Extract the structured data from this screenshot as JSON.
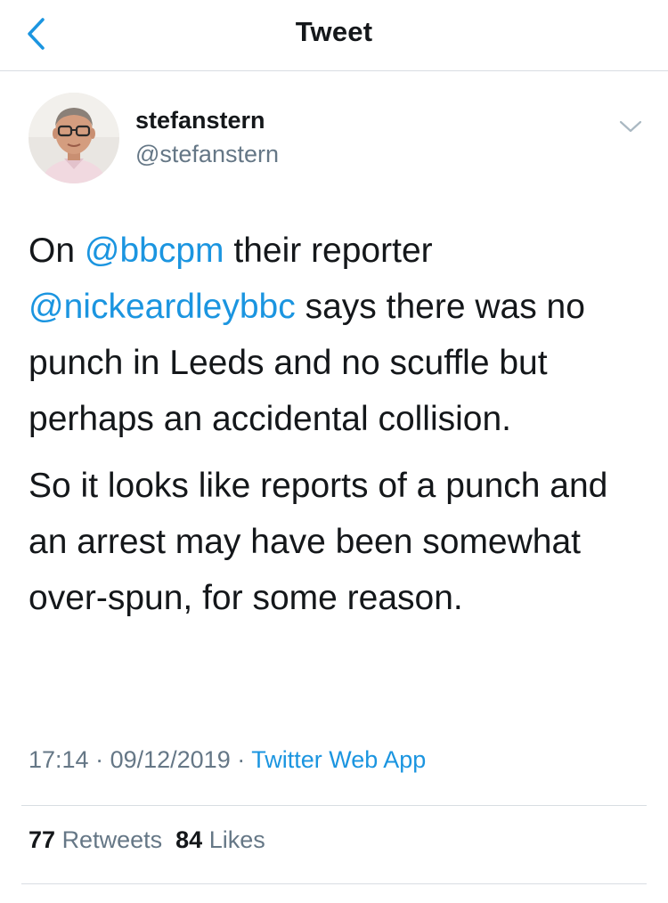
{
  "header": {
    "title": "Tweet",
    "back_icon": "chevron-left-icon"
  },
  "author": {
    "display_name": "stefanstern",
    "handle": "@stefanstern"
  },
  "tweet": {
    "p1": {
      "t1": "On ",
      "m1": "@bbcpm",
      "t2": " their reporter ",
      "m2": "@nickeardleybbc",
      "t3": " says there was no punch in Leeds and no scuffle but perhaps an accidental collision."
    },
    "p2": "So it looks like reports of a punch and an arrest may have been somewhat over-spun, for some reason."
  },
  "meta": {
    "time": "17:14",
    "date": "09/12/2019",
    "separator": " · ",
    "source": "Twitter Web App"
  },
  "stats": {
    "retweets_count": "77",
    "retweets_label": "Retweets",
    "likes_count": "84",
    "likes_label": "Likes"
  },
  "colors": {
    "accent": "#1b95e0",
    "muted": "#657786",
    "text": "#14171a",
    "divider": "#d8dde2"
  }
}
